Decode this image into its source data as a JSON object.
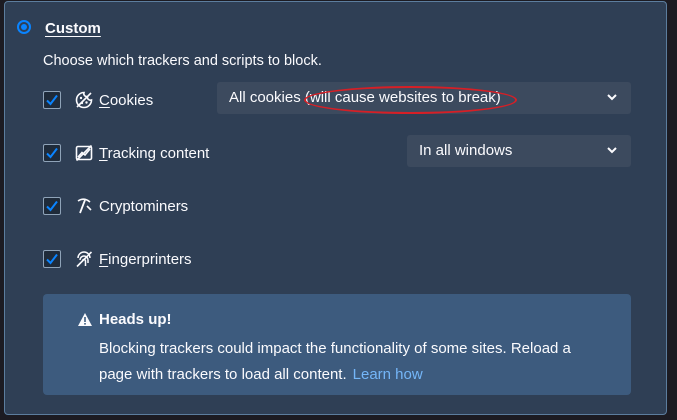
{
  "section": {
    "title": "Custom",
    "description": "Choose which trackers and scripts to block."
  },
  "options": [
    {
      "label_first": "C",
      "label_rest": "ookies",
      "checked": true,
      "icon": "cookie-icon",
      "select_value": "All cookies (will cause websites to break)"
    },
    {
      "label_first": "T",
      "label_rest": "racking content",
      "checked": true,
      "icon": "tracking-content-icon",
      "select_value": "In all windows"
    },
    {
      "label_first": "",
      "label_rest": "Cryptominers",
      "checked": true,
      "icon": "cryptominer-icon"
    },
    {
      "label_first": "F",
      "label_rest": "ingerprinters",
      "checked": true,
      "icon": "fingerprint-icon"
    }
  ],
  "warning": {
    "title": "Heads up!",
    "body": "Blocking trackers could impact the functionality of some sites. Reload a page with trackers to load all content.",
    "link": "Learn how"
  },
  "colors": {
    "accent": "#0a84ff",
    "annotation": "#d61f26",
    "link": "#74b6f8"
  }
}
